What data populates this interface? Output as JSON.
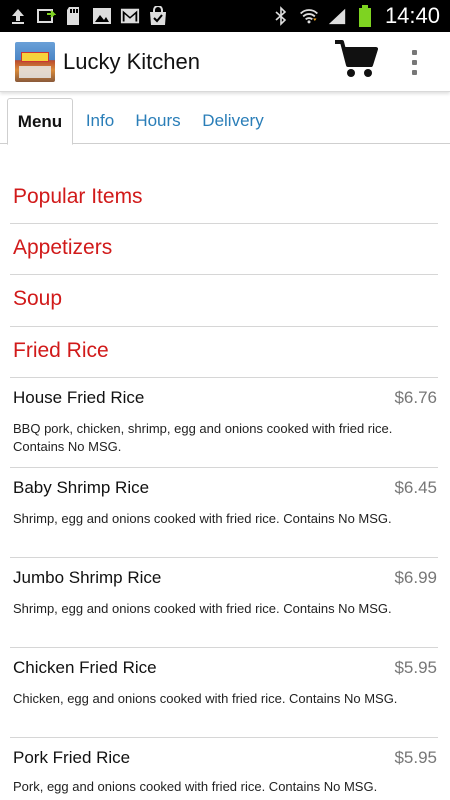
{
  "status_bar": {
    "time": "14:40",
    "left_icons": [
      "upload-icon",
      "usb-debug-icon",
      "sd-card-icon",
      "image-icon",
      "gmail-icon",
      "shopping-bag-icon"
    ],
    "right_icons": [
      "bluetooth-icon",
      "wifi-icon",
      "signal-icon",
      "battery-icon"
    ],
    "battery_color": "#7ed321"
  },
  "app_bar": {
    "title": "Lucky Kitchen",
    "cart_icon": "cart-icon",
    "overflow_icon": "overflow-menu-icon"
  },
  "tabs": [
    {
      "label": "Menu",
      "active": true
    },
    {
      "label": "Info",
      "active": false
    },
    {
      "label": "Hours",
      "active": false
    },
    {
      "label": "Delivery",
      "active": false
    }
  ],
  "categories": [
    {
      "label": "Popular Items"
    },
    {
      "label": "Appetizers"
    },
    {
      "label": "Soup"
    },
    {
      "label": "Fried Rice"
    }
  ],
  "items": [
    {
      "name": "House Fried Rice",
      "price": "$6.76",
      "description": "BBQ pork, chicken, shrimp, egg and onions cooked with fried rice. Contains No MSG."
    },
    {
      "name": "Baby Shrimp Rice",
      "price": "$6.45",
      "description": "Shrimp, egg and onions cooked with fried rice. Contains No MSG."
    },
    {
      "name": "Jumbo Shrimp Rice",
      "price": "$6.99",
      "description": "Shrimp, egg and onions cooked with fried rice. Contains No MSG."
    },
    {
      "name": "Chicken Fried Rice",
      "price": "$5.95",
      "description": "Chicken, egg and onions cooked with fried rice. Contains No MSG."
    },
    {
      "name": "Pork Fried Rice",
      "price": "$5.95",
      "description": "Pork, egg and onions cooked with fried rice. Contains No MSG."
    }
  ],
  "colors": {
    "category_text": "#d11a1a",
    "tab_text": "#2a7eb8",
    "price_text": "#777777"
  }
}
